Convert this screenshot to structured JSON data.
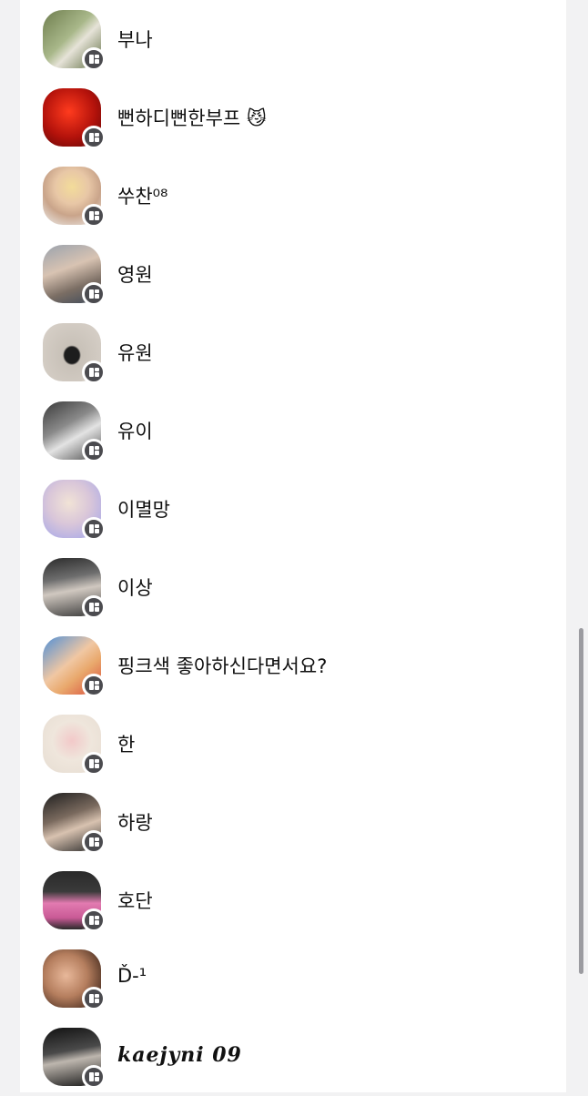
{
  "contacts": [
    {
      "name": "부나"
    },
    {
      "name": "뻔하디뻔한부프 😼"
    },
    {
      "name": "쑤찬⁰⁸"
    },
    {
      "name": "영원"
    },
    {
      "name": "유원"
    },
    {
      "name": "유이"
    },
    {
      "name": "이멸망"
    },
    {
      "name": "이상"
    },
    {
      "name": "핑크색 좋아하신다면서요?"
    },
    {
      "name": "한"
    },
    {
      "name": "하랑"
    },
    {
      "name": "호단"
    },
    {
      "name": "Ď-¹"
    },
    {
      "name": "kaejyni 09"
    }
  ],
  "badge_icon": "card-profile-icon",
  "colors": {
    "background": "#f2f2f3",
    "panel": "#ffffff",
    "badge": "#4b4b4f",
    "text": "#111111"
  }
}
